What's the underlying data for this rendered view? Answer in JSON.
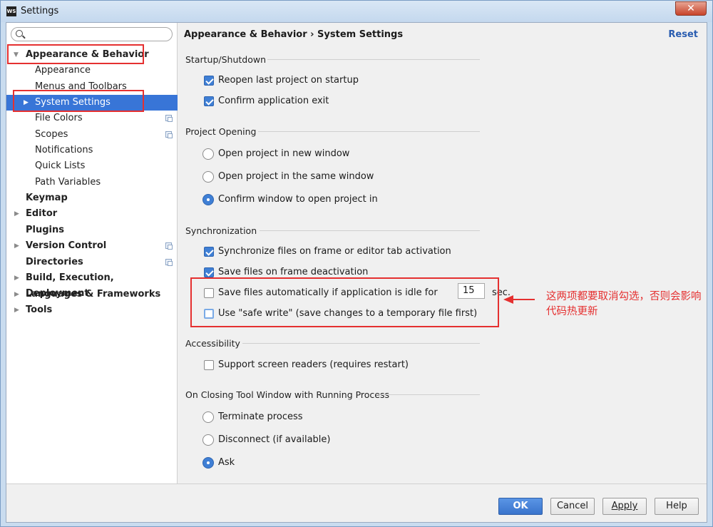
{
  "window": {
    "title": "Settings",
    "app_icon": "WS",
    "close_label": "✕"
  },
  "search": {
    "placeholder": "",
    "value": ""
  },
  "sidebar": {
    "items": [
      {
        "label": "Appearance & Behavior",
        "expanded": true
      },
      {
        "label": "Appearance"
      },
      {
        "label": "Menus and Toolbars"
      },
      {
        "label": "System Settings",
        "selected": true
      },
      {
        "label": "File Colors"
      },
      {
        "label": "Scopes"
      },
      {
        "label": "Notifications"
      },
      {
        "label": "Quick Lists"
      },
      {
        "label": "Path Variables"
      },
      {
        "label": "Keymap"
      },
      {
        "label": "Editor"
      },
      {
        "label": "Plugins"
      },
      {
        "label": "Version Control"
      },
      {
        "label": "Directories"
      },
      {
        "label": "Build, Execution, Deployment"
      },
      {
        "label": "Languages & Frameworks"
      },
      {
        "label": "Tools"
      }
    ]
  },
  "header": {
    "breadcrumb": "Appearance & Behavior › System Settings",
    "reset": "Reset"
  },
  "sections": {
    "startup": {
      "title": "Startup/Shutdown",
      "reopen": {
        "label": "Reopen last project on startup",
        "checked": true
      },
      "confirm_exit": {
        "label": "Confirm application exit",
        "checked": true
      }
    },
    "project_opening": {
      "title": "Project Opening",
      "new_window": {
        "label": "Open project in new window",
        "checked": false
      },
      "same_window": {
        "label": "Open project in the same window",
        "checked": false
      },
      "confirm_window": {
        "label": "Confirm window to open project in",
        "checked": true
      }
    },
    "sync": {
      "title": "Synchronization",
      "sync_files": {
        "label": "Synchronize files on frame or editor tab activation",
        "checked": true
      },
      "save_deactivation": {
        "label": "Save files on frame deactivation",
        "checked": true
      },
      "save_idle": {
        "label": "Save files automatically if application is idle for",
        "checked": false,
        "value": "15",
        "unit": "sec."
      },
      "safe_write": {
        "label": "Use \"safe write\" (save changes to a temporary file first)",
        "checked": false
      }
    },
    "accessibility": {
      "title": "Accessibility",
      "screen_readers": {
        "label": "Support screen readers (requires restart)",
        "checked": false
      }
    },
    "closing": {
      "title": "On Closing Tool Window with Running Process",
      "terminate": {
        "label": "Terminate process",
        "checked": false
      },
      "disconnect": {
        "label": "Disconnect (if available)",
        "checked": false
      },
      "ask": {
        "label": "Ask",
        "checked": true
      }
    }
  },
  "annotation": {
    "text": "这两项都要取消勾选，否则会影响代码热更新",
    "color": "#e53030"
  },
  "buttons": {
    "ok": "OK",
    "cancel": "Cancel",
    "apply": "Apply",
    "help": "Help"
  }
}
